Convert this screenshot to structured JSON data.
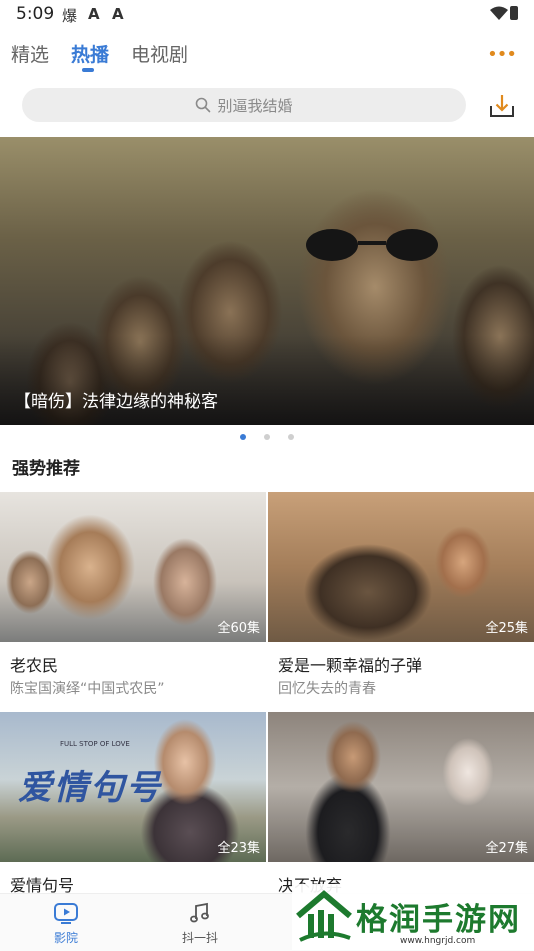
{
  "status_bar": {
    "time": "5:09",
    "notifications": [
      "爆",
      "A",
      "A"
    ]
  },
  "top_tabs": [
    {
      "label": "精选",
      "active": false
    },
    {
      "label": "热播",
      "active": true
    },
    {
      "label": "电视剧",
      "active": false
    }
  ],
  "more_icon": "more-dots-icon",
  "search": {
    "placeholder": "别逼我结婚"
  },
  "banner": {
    "caption": "【暗伤】法律边缘的神秘客",
    "pages": 3,
    "current_page": 1
  },
  "section": {
    "title": "强势推荐"
  },
  "cards": [
    {
      "title": "老农民",
      "subtitle": "陈宝国演绎“中国式农民”",
      "episodes": "全60集"
    },
    {
      "title": "爱是一颗幸福的子弹",
      "subtitle": "回忆失去的青春",
      "episodes": "全25集"
    },
    {
      "title": "爱情句号",
      "subtitle": "",
      "episodes": "全23集",
      "poster_text": "爱情句号",
      "poster_tag": "FULL STOP OF LOVE"
    },
    {
      "title": "决不放弃",
      "subtitle": "",
      "episodes": "全27集"
    }
  ],
  "bottom_nav": [
    {
      "label": "影院",
      "icon": "play-video-icon",
      "active": true
    },
    {
      "label": "抖一抖",
      "icon": "music-note-icon",
      "active": false
    }
  ],
  "watermark": {
    "text": "格润手游网",
    "url": "www.hngrjd.com"
  },
  "colors": {
    "accent": "#3a7bd5",
    "more_icon": "#e08a1e",
    "watermark_green": "#1d7a2e"
  }
}
